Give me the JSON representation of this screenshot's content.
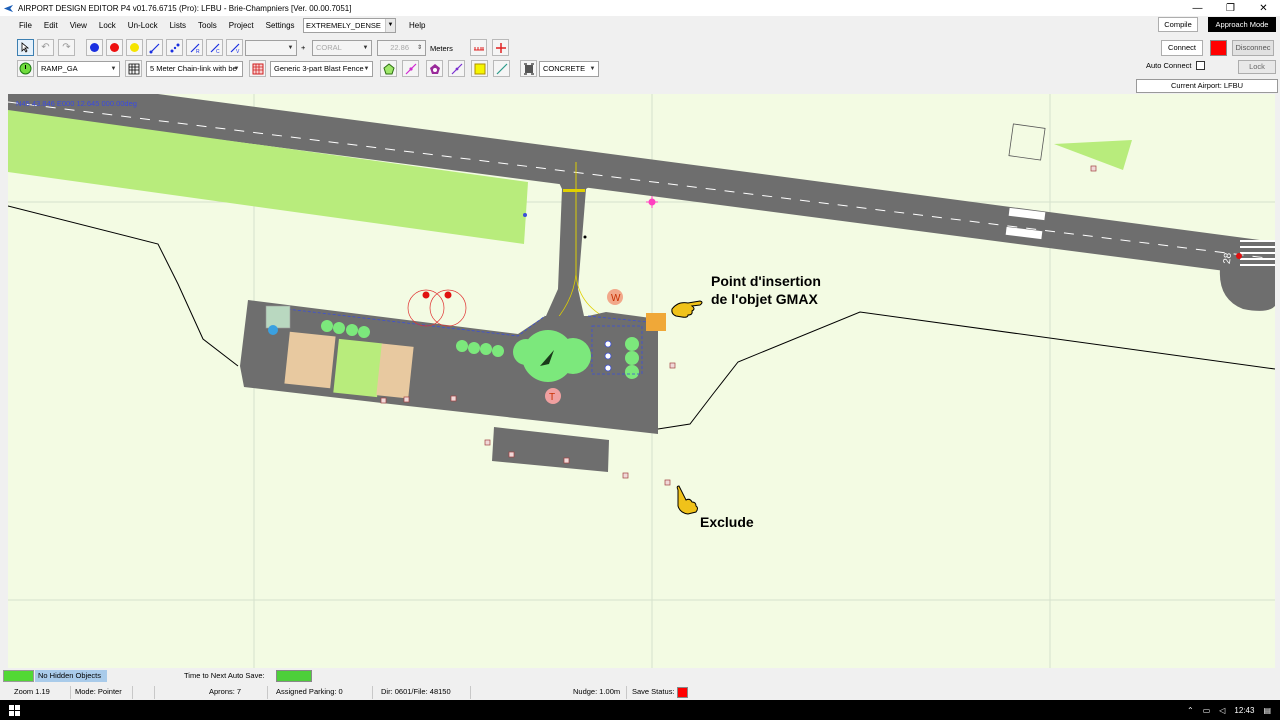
{
  "window": {
    "title": "AIRPORT DESIGN EDITOR P4  v01.76.6715  (Pro): LFBU - Brie-Champniers [Ver. 00.00.7051]",
    "controls": [
      "—",
      "❐",
      "✕"
    ]
  },
  "menu": {
    "items": [
      "File",
      "Edit",
      "View",
      "Lock",
      "Un-Lock",
      "Lists",
      "Tools",
      "Project",
      "Settings"
    ],
    "density": "EXTREMELY_DENSE",
    "help": "Help"
  },
  "toolbar1": {
    "tool_symbols": [
      "↖",
      "↶",
      "↷",
      "●",
      "●",
      "●",
      "⟋",
      "⟋",
      "⟋",
      "⟋",
      "⟋",
      "⟋"
    ],
    "blank_combo": "",
    "surface_disabled": "CORAL",
    "width_value": "22.86",
    "units": "Meters"
  },
  "toolbar2": {
    "ramp_type": "RAMP_GA",
    "fence_type": "5 Meter Chain-link with be",
    "blast_fence": "Generic 3-part Blast Fence",
    "surface": "CONCRETE"
  },
  "right_panel": {
    "compile": "Compile",
    "approach_mode": "Approach Mode",
    "connect": "Connect",
    "disconnect": "Disconnec",
    "auto_connect": "Auto Connect",
    "lock": "Lock",
    "current_airport": "Current Airport: LFBU",
    "status_color": "#ff0000"
  },
  "map": {
    "coordinates": "N45 43.846   E000 12.645 000.00deg",
    "runway_number": "28",
    "wind_label": "W",
    "tower_label": "T",
    "annotation_gmax_line1": "Point d'insertion",
    "annotation_gmax_line2": "de l'objet GMAX",
    "annotation_exclude": "Exclude",
    "colors": {
      "background": "#f3fbe3",
      "pavement": "#6e6e6e",
      "grass": "#b8ec7c",
      "tree": "#7ce87c",
      "selection": "#3b4fd8",
      "building": "#e8c9a0"
    }
  },
  "status": {
    "hidden_objects": "No Hidden Objects",
    "auto_save": "Time to Next Auto Save:",
    "zoom": "Zoom 1.19",
    "mode": "Mode: Pointer",
    "aprons": "Aprons: 7",
    "parking": "Assigned Parking: 0",
    "dir": "Dir: 0601/File: 48150",
    "nudge": "Nudge: 1.00m",
    "save_status": "Save Status:"
  },
  "taskbar": {
    "time": "12:43"
  }
}
